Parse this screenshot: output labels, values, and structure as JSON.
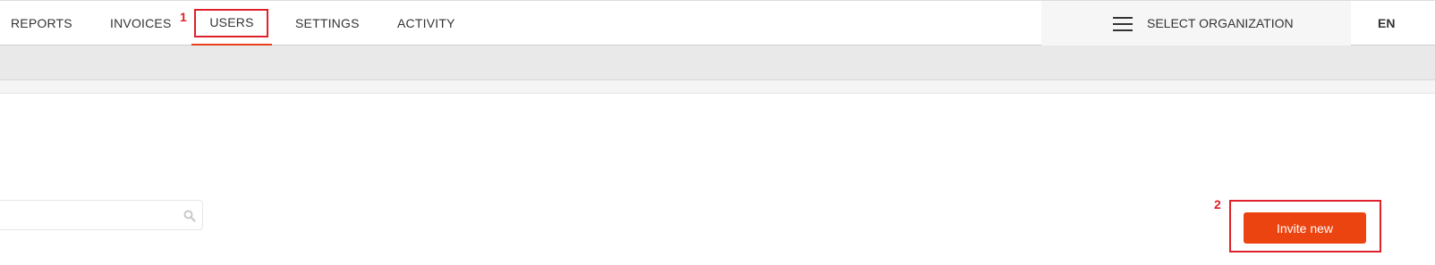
{
  "nav": {
    "items": [
      {
        "label": "REPORTS"
      },
      {
        "label": "INVOICES"
      },
      {
        "label": "USERS"
      },
      {
        "label": "SETTINGS"
      },
      {
        "label": "ACTIVITY"
      }
    ],
    "active": "USERS"
  },
  "org_selector": {
    "label": "SELECT ORGANIZATION"
  },
  "language": {
    "label": "EN"
  },
  "search": {
    "placeholder": "",
    "value": "",
    "icon": "search-icon"
  },
  "invite": {
    "label": "Invite new"
  },
  "callouts": [
    {
      "number": "1"
    },
    {
      "number": "2"
    }
  ],
  "colors": {
    "accent": "#ec4410",
    "callout": "#e0202a"
  }
}
